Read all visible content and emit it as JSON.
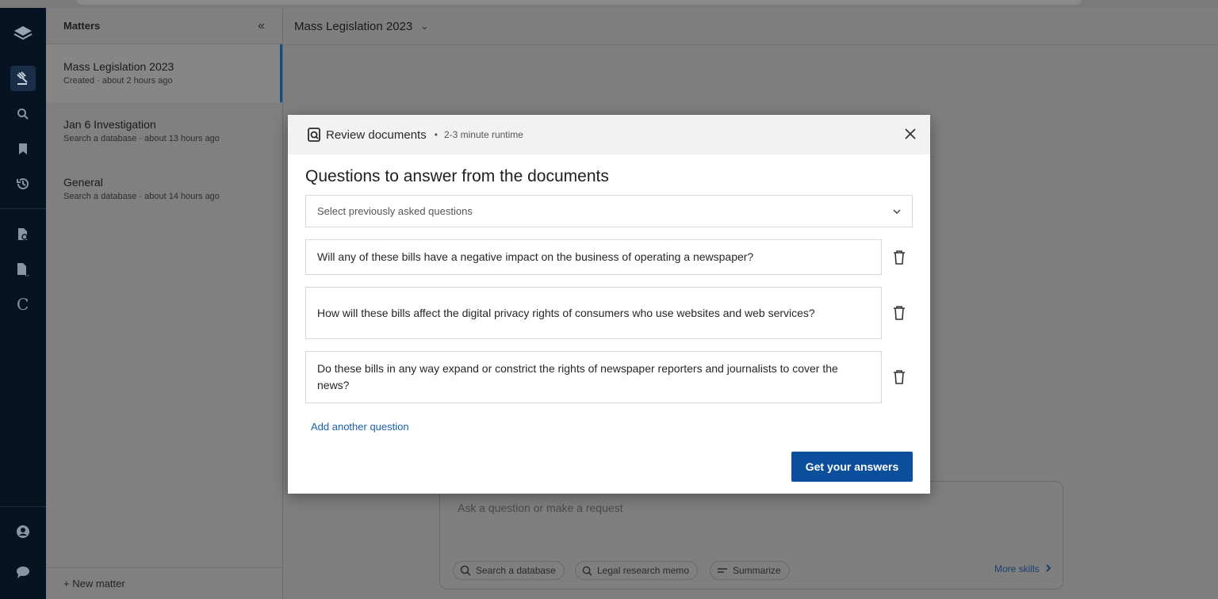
{
  "sidebar": {
    "collapse_glyph": "«",
    "title": "Matters",
    "items": [
      {
        "name": "Mass Legislation 2023",
        "meta": "Created  ·  about 2 hours ago"
      },
      {
        "name": "Jan 6 Investigation",
        "meta": "Search a database  ·  about 13 hours ago"
      },
      {
        "name": "General",
        "meta": "Search a database  ·  about 14 hours ago"
      }
    ],
    "new_matter": "+  New matter"
  },
  "header": {
    "title": "Mass Legislation 2023",
    "chevron": "⌄"
  },
  "ask": {
    "placeholder": "Ask a question or make a request",
    "chips": [
      "Search a database",
      "Legal research memo",
      "Summarize"
    ],
    "more_skills": "More skills"
  },
  "modal": {
    "title": "Review documents",
    "separator": "•",
    "runtime": "2-3 minute runtime",
    "heading": "Questions to answer from the documents",
    "select_placeholder": "Select previously asked questions",
    "questions": [
      "Will any of these bills have a negative impact on the business of operating a newspaper?",
      "How will these bills affect the digital privacy rights of consumers who use websites and web services?",
      "Do these bills in any way expand or constrict the rights of newspaper reporters and journalists to cover the news?"
    ],
    "add_question": "Add another question",
    "submit": "Get your answers"
  },
  "colors": {
    "primary": "#0b4e9b",
    "link": "#1860ad",
    "rail": "#051322",
    "overlay": "#808080"
  }
}
